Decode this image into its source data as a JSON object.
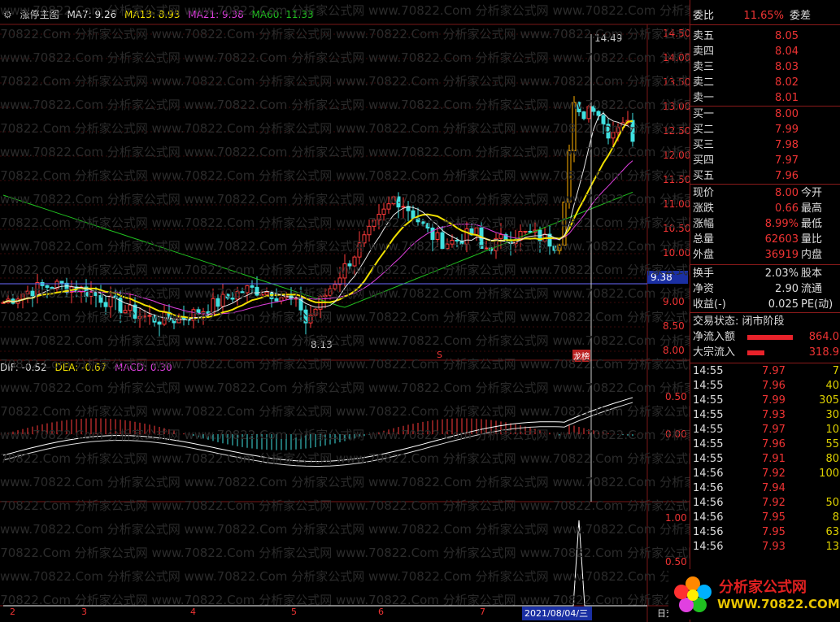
{
  "main_legend": {
    "indicator": "涨停主图",
    "ma7": "MA7: 9.26",
    "ma13": "MA13: 8.93",
    "ma21": "MA21: 9.38",
    "ma60": "MA60: 11.33",
    "colors": {
      "ma7": "#e8e8e8",
      "ma13": "#f0e000",
      "ma21": "#e040e0",
      "ma60": "#20c020"
    }
  },
  "macd_legend": {
    "dif": "DIF: -0.52",
    "dea": "DEA: -0.67",
    "macd": "MACD: 0.30"
  },
  "price_axis": [
    "14.50",
    "14.00",
    "13.50",
    "13.00",
    "12.50",
    "12.00",
    "11.50",
    "11.00",
    "10.50",
    "10.00",
    "9.50",
    "9.00",
    "8.50",
    "8.00"
  ],
  "macd_axis": [
    "0.50",
    "0.00"
  ],
  "sub_axis": [
    "1.00",
    "0.50"
  ],
  "current_price_marker": "9.38",
  "annotations": {
    "high": "14.49",
    "low": "8.13",
    "dragon": "龙榜",
    "s_mark": "S"
  },
  "date_axis": {
    "labels": [
      "2",
      "3",
      "4",
      "5",
      "6",
      "7"
    ],
    "selected": "2021/08/04/三",
    "right": "日交"
  },
  "quote": {
    "header": {
      "label": "委比",
      "value": "11.65%",
      "label2": "委差"
    },
    "asks": [
      {
        "label": "卖五",
        "price": "8.05"
      },
      {
        "label": "卖四",
        "price": "8.04"
      },
      {
        "label": "卖三",
        "price": "8.03"
      },
      {
        "label": "卖二",
        "price": "8.02"
      },
      {
        "label": "卖一",
        "price": "8.01"
      }
    ],
    "bids": [
      {
        "label": "买一",
        "price": "8.00"
      },
      {
        "label": "买二",
        "price": "7.99"
      },
      {
        "label": "买三",
        "price": "7.98"
      },
      {
        "label": "买四",
        "price": "7.97"
      },
      {
        "label": "买五",
        "price": "7.96"
      }
    ],
    "stats": [
      {
        "k": "现价",
        "v": "8.00",
        "k2": "今开"
      },
      {
        "k": "涨跌",
        "v": "0.66",
        "k2": "最高"
      },
      {
        "k": "涨幅",
        "v": "8.99%",
        "k2": "最低"
      },
      {
        "k": "总量",
        "v": "62603",
        "k2": "量比"
      },
      {
        "k": "外盘",
        "v": "36919",
        "k2": "内盘"
      }
    ],
    "stats2": [
      {
        "k": "换手",
        "v": "2.03%",
        "k2": "股本"
      },
      {
        "k": "净资",
        "v": "2.90",
        "k2": "流通"
      },
      {
        "k": "收益(-)",
        "v": "0.025",
        "k2": "PE(动)"
      }
    ],
    "status": "交易状态: 闭市阶段",
    "flow": [
      {
        "k": "净流入额",
        "v": "864.0",
        "frac": 0.8
      },
      {
        "k": "大宗流入",
        "v": "318.9",
        "frac": 0.3
      }
    ]
  },
  "ticks": [
    {
      "t": "14:55",
      "p": "7.97",
      "v": "7"
    },
    {
      "t": "14:55",
      "p": "7.96",
      "v": "40"
    },
    {
      "t": "14:55",
      "p": "7.99",
      "v": "305"
    },
    {
      "t": "14:55",
      "p": "7.93",
      "v": "30"
    },
    {
      "t": "14:55",
      "p": "7.97",
      "v": "10"
    },
    {
      "t": "14:55",
      "p": "7.96",
      "v": "55"
    },
    {
      "t": "14:55",
      "p": "7.91",
      "v": "80"
    },
    {
      "t": "14:56",
      "p": "7.92",
      "v": "100"
    },
    {
      "t": "14:56",
      "p": "7.94",
      "v": ""
    },
    {
      "t": "14:56",
      "p": "7.92",
      "v": "50"
    },
    {
      "t": "14:56",
      "p": "7.95",
      "v": "8"
    },
    {
      "t": "14:56",
      "p": "7.95",
      "v": "63"
    },
    {
      "t": "14:56",
      "p": "7.93",
      "v": "13"
    }
  ],
  "logo": {
    "title": "分析家公式网",
    "url": "WWW.70822.COM"
  },
  "watermark": "www.70822.Com 分析家公式网"
}
